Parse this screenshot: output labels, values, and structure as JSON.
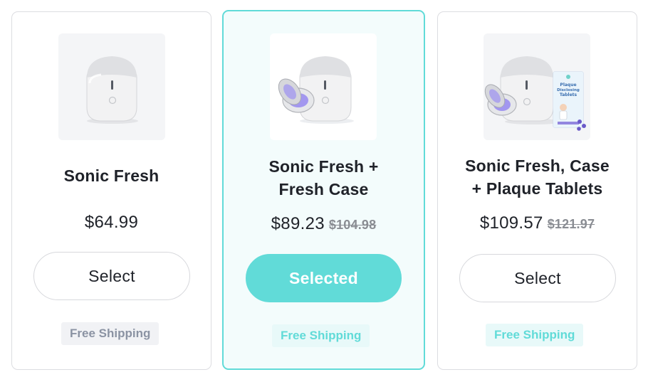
{
  "colors": {
    "accent": "#61dbd8",
    "selected_bg": "#f3fcfc",
    "muted_text": "#8b93a3",
    "strike": "#8a8d93"
  },
  "products": [
    {
      "title_lines": [
        "Sonic Fresh"
      ],
      "image": "toothbrush-sanitizer-image",
      "price": "$64.99",
      "original_price": "",
      "button_label": "Select",
      "selected": false,
      "shipping": "Free Shipping"
    },
    {
      "title_lines": [
        "Sonic Fresh +",
        "Fresh Case"
      ],
      "image": "sanitizer-with-case-image",
      "price": "$89.23",
      "original_price": "$104.98",
      "button_label": "Selected",
      "selected": true,
      "shipping": "Free Shipping"
    },
    {
      "title_lines": [
        "Sonic Fresh, Case",
        "+ Plaque Tablets"
      ],
      "image": "sanitizer-case-tablets-image",
      "price": "$109.57",
      "original_price": "$121.97",
      "button_label": "Select",
      "selected": false,
      "shipping": "Free Shipping",
      "box_text": [
        "Plaque",
        "Disclosing",
        "Tablets"
      ]
    }
  ]
}
